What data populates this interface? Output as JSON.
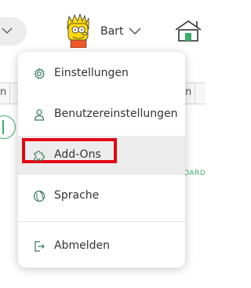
{
  "header": {
    "user_name": "Bart",
    "avatar": "bart-simpson-avatar",
    "left_control_icon": "chevron-down-icon",
    "right_icon": "house-icon"
  },
  "background": {
    "row_left": "n",
    "row_right": "n",
    "board_text": "OARD",
    "accent_color": "#3cae6a"
  },
  "menu": {
    "items": [
      {
        "label": "Einstellungen",
        "icon": "gear-icon"
      },
      {
        "label": "Benutzereinstellungen",
        "icon": "user-icon"
      },
      {
        "label": "Add-Ons",
        "icon": "puzzle-icon",
        "hovered": true,
        "highlighted": true
      },
      {
        "label": "Sprache",
        "icon": "globe-icon"
      },
      {
        "label": "Abmelden",
        "icon": "logout-icon"
      }
    ],
    "highlight_color": "#e30613",
    "hover_color": "#ececec"
  }
}
